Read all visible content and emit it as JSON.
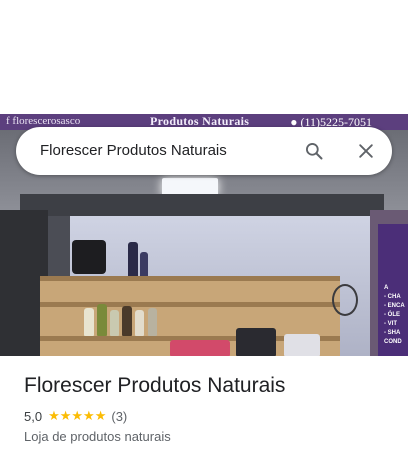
{
  "sign": {
    "left_text": "f florescerosasco",
    "center_text": "Produtos Naturais",
    "right_text": "● (11)5225-7051"
  },
  "banner": {
    "lines": [
      "A",
      "- CHA",
      "- ENCA",
      "- ÓLE",
      "- VIT",
      "- SHA",
      "COND"
    ]
  },
  "search": {
    "query": "Florescer Produtos Naturais",
    "icons": [
      "search-icon",
      "close-icon"
    ]
  },
  "place": {
    "title": "Florescer Produtos Naturais",
    "rating": "5,0",
    "stars": "★★★★★",
    "rating_value": 5.0,
    "review_count": "(3)",
    "category": "Loja de produtos naturais"
  },
  "colors": {
    "star": "#fbbc04",
    "title": "#202124",
    "secondary": "#5f6368",
    "sign": "#5c3f7e"
  }
}
